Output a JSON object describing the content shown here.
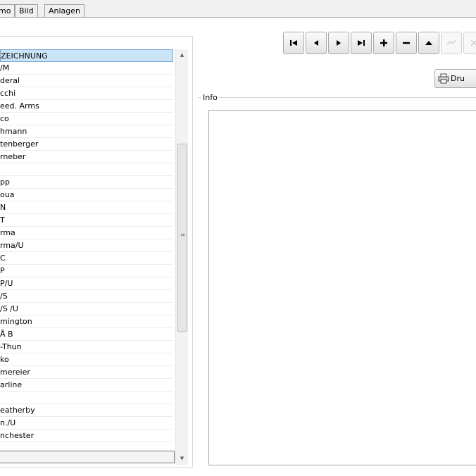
{
  "tabs": [
    "mo",
    "Bild",
    "Anlagen"
  ],
  "list": {
    "selected_index": 0,
    "items": [
      "ZEICHNUNG",
      "/M",
      "deral",
      "cchi",
      "eed. Arms",
      "co",
      "hmann",
      "tenberger",
      "rneber",
      "",
      "pp",
      "oua",
      "N",
      "T",
      "rma",
      "rma/U",
      "C",
      "P",
      "P/U",
      "/S",
      "/S /U",
      "mington",
      "Å B",
      "-Thun",
      "ko",
      "mereier",
      "arline",
      "",
      "eatherby",
      "n./U",
      "nchester"
    ]
  },
  "toolbar": {
    "buttons": [
      {
        "name": "first-record-button",
        "icon": "first-icon",
        "enabled": true
      },
      {
        "name": "prev-record-button",
        "icon": "prev-icon",
        "enabled": true
      },
      {
        "name": "next-record-button",
        "icon": "next-icon",
        "enabled": true
      },
      {
        "name": "last-record-button",
        "icon": "last-icon",
        "enabled": true
      },
      {
        "name": "add-record-button",
        "icon": "plus-icon",
        "enabled": true
      },
      {
        "name": "delete-record-button",
        "icon": "minus-icon",
        "enabled": true
      },
      {
        "name": "edit-record-button",
        "icon": "up-triangle-icon",
        "enabled": true
      },
      {
        "name": "post-record-button",
        "icon": "check-icon",
        "enabled": false
      },
      {
        "name": "cancel-record-button",
        "icon": "cross-icon",
        "enabled": false
      }
    ]
  },
  "print": {
    "label": "Dru"
  },
  "info": {
    "title": "Info"
  },
  "colors": {
    "selected_row": "#cce4f7",
    "border": "#a9a9a9",
    "background": "#f0f0f0"
  }
}
